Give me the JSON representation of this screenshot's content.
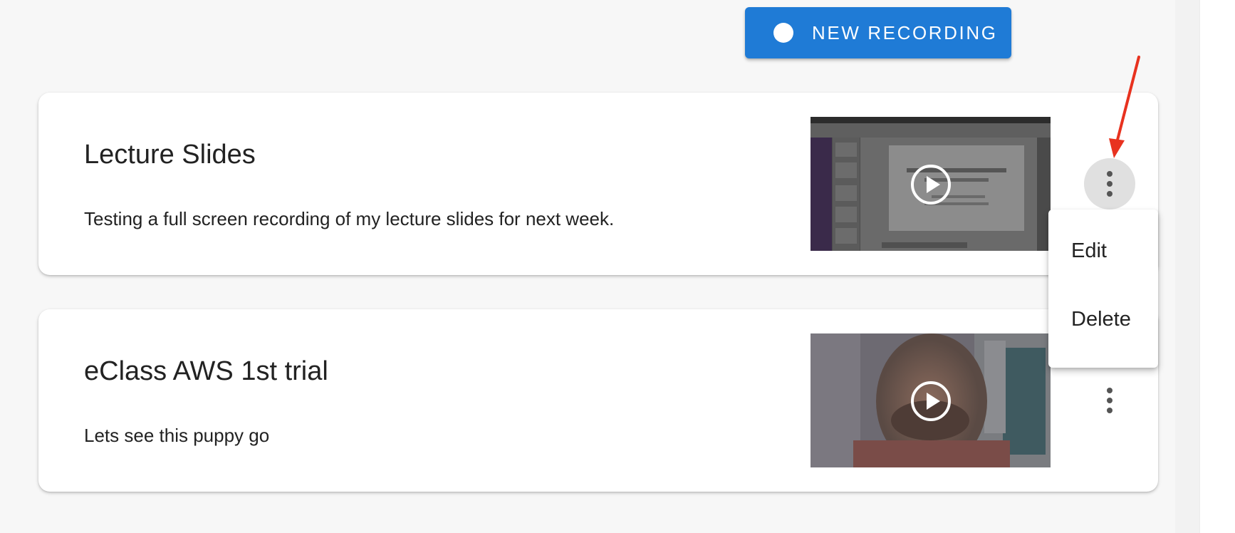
{
  "toolbar": {
    "new_recording_label": "NEW RECORDING"
  },
  "recordings": [
    {
      "title": "Lecture Slides",
      "description": "Testing a full screen recording of my lecture slides for next week.",
      "thumbnail_icon": "play-circle-icon",
      "menu_icon": "more-vert-icon"
    },
    {
      "title": "eClass AWS 1st trial",
      "description": "Lets see this puppy go",
      "thumbnail_icon": "play-circle-icon",
      "menu_icon": "more-vert-icon"
    }
  ],
  "context_menu": {
    "items": [
      {
        "label": "Edit"
      },
      {
        "label": "Delete"
      }
    ]
  },
  "colors": {
    "primary": "#1f7bd6",
    "background": "#f7f7f7",
    "card": "#ffffff",
    "annotation": "#e8321f"
  }
}
